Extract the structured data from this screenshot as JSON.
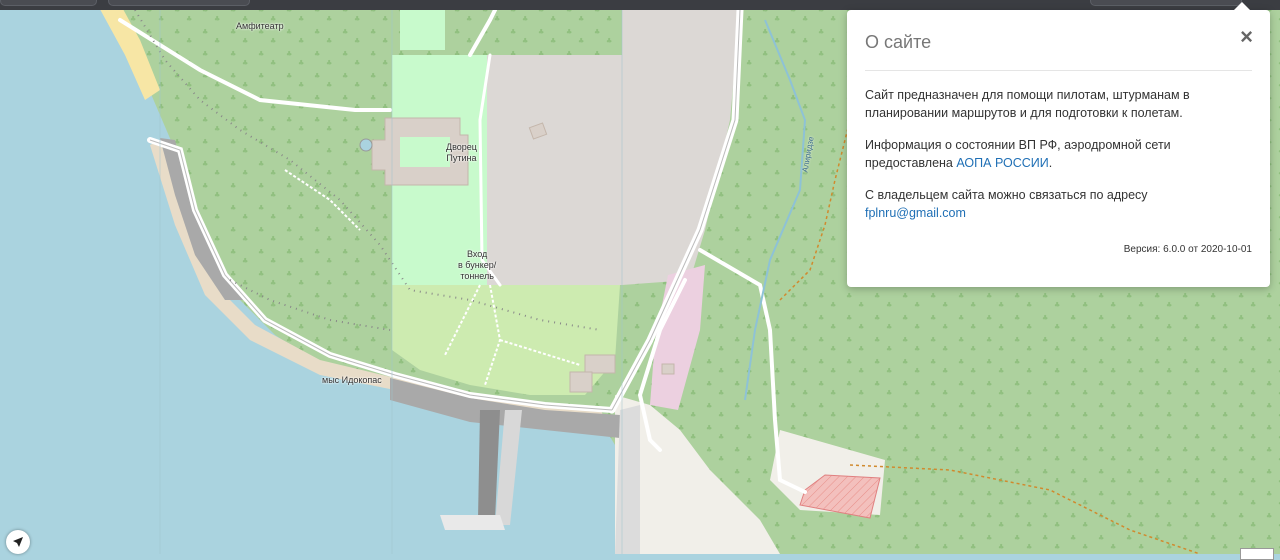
{
  "map": {
    "labels": {
      "amphitheater": "Амфитеатр",
      "palace": "Дворец\nПутина",
      "bunker": "Вход\nв бункер/\nтоннель",
      "cape": "мыс Идокопас",
      "stream": "Алиридзе"
    },
    "colors": {
      "water": "#aad3df",
      "forest": "#add19e",
      "grass": "#cdebb0",
      "garden": "#c8facc",
      "sand": "#f1e4c9",
      "industrial": "#dcd8d5",
      "military": "#f3c0bd",
      "pink": "#ecd0e0",
      "pier": "#a1a1a1"
    }
  },
  "popover": {
    "title": "О сайте",
    "close_label": "×",
    "p1": "Сайт предназначен для помощи пилотам, штурманам в планировании маршрутов и для подготовки к полетам.",
    "p2_text": "Информация о состоянии ВП РФ, аэродромной сети предоставлена ",
    "p2_link": "АОПА РОССИИ",
    "p2_end": ".",
    "p3_text": "С владельцем сайта можно связаться по адресу",
    "email": "fplnru@gmail.com",
    "version": "Версия: 6.0.0 от 2020-10-01"
  },
  "controls": {
    "locate_icon": "navigation-arrow-icon"
  }
}
